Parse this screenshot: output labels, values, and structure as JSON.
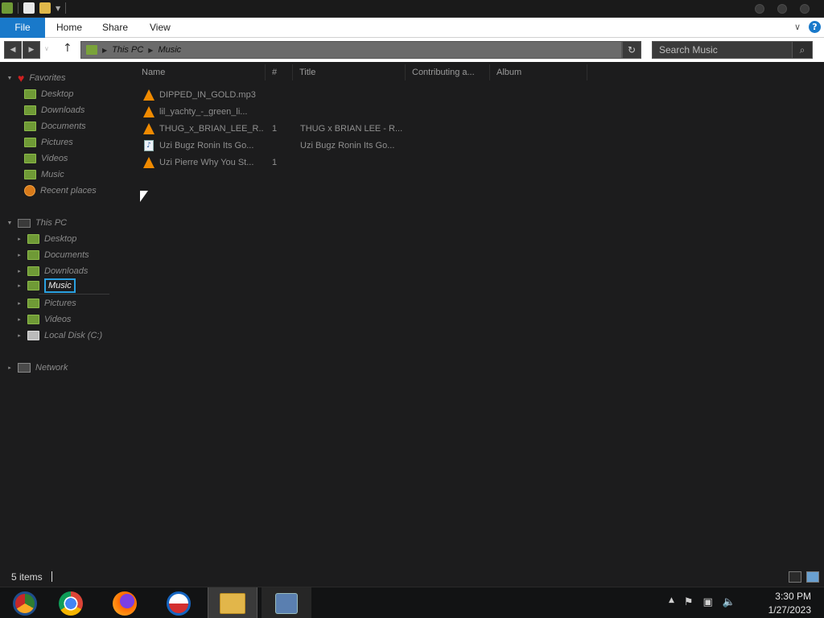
{
  "ribbon": {
    "tabs": [
      "File",
      "Home",
      "Share",
      "View"
    ]
  },
  "address": {
    "crumbs": [
      "This PC",
      "Music"
    ]
  },
  "search": {
    "placeholder": "Search Music"
  },
  "nav": {
    "favorites_label": "Favorites",
    "favorites": [
      "Desktop",
      "Downloads",
      "Documents",
      "Pictures",
      "Videos",
      "Music",
      "Recent places"
    ],
    "thispc_label": "This PC",
    "thispc": [
      "Desktop",
      "Documents",
      "Downloads",
      "Music",
      "Pictures",
      "Videos",
      "Local Disk (C:)"
    ],
    "network_label": "Network",
    "selected": "Music"
  },
  "list": {
    "columns": [
      "Name",
      "#",
      "Title",
      "Contributing a...",
      "Album"
    ],
    "rows": [
      {
        "name": "DIPPED_IN_GOLD.mp3",
        "num": "",
        "title": "",
        "icon": "vlc-icon"
      },
      {
        "name": "lil_yachty_-_green_li...",
        "num": "",
        "title": "",
        "icon": "vlc-icon"
      },
      {
        "name": "THUG_x_BRIAN_LEE_R...",
        "num": "1",
        "title": "THUG x BRIAN LEE - R...",
        "icon": "vlc-icon"
      },
      {
        "name": "Uzi Bugz Ronin Its Go...",
        "num": "",
        "title": "Uzi Bugz Ronin Its Go...",
        "icon": "audio-file-icon"
      },
      {
        "name": "Uzi Pierre Why You St...",
        "num": "1",
        "title": "",
        "icon": "vlc-icon"
      }
    ]
  },
  "status": {
    "count": "5 items"
  },
  "taskbar": {
    "time": "3:30 PM",
    "date": "1/27/2023"
  },
  "colors": {
    "accent": "#1979ca",
    "selection_border": "#2aa0e0",
    "folder_green": "#6f9a36",
    "vlc_orange": "#f08a00"
  }
}
